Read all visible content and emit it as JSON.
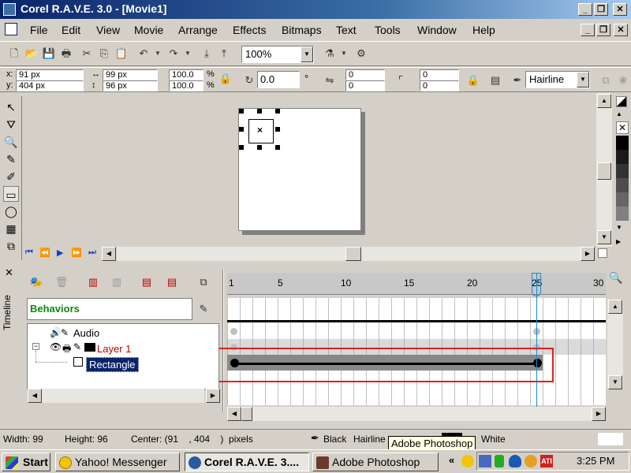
{
  "window": {
    "title": "Corel R.A.V.E. 3.0 - [Movie1]"
  },
  "menu": [
    "File",
    "Edit",
    "View",
    "Movie",
    "Arrange",
    "Effects",
    "Bitmaps",
    "Text",
    "Tools",
    "Window",
    "Help"
  ],
  "toolbar": {
    "zoom": "100%"
  },
  "propbar": {
    "x": "91 px",
    "y": "404 px",
    "w": "99 px",
    "h": "96 px",
    "scale_x": "100.0",
    "scale_y": "100.0",
    "pct": "%",
    "rotation": "0.0",
    "deg": "°",
    "pos1": "0",
    "pos2": "0",
    "pos3": "0",
    "pos4": "0",
    "outline": "Hairline"
  },
  "timeline": {
    "panel_label": "Timeline",
    "behaviors": "Behaviors",
    "frames": [
      "1",
      "5",
      "10",
      "15",
      "20",
      "25",
      "30"
    ],
    "layers": [
      {
        "name": "Audio"
      },
      {
        "name": "Layer 1"
      },
      {
        "name": "Rectangle"
      }
    ]
  },
  "statusbar": {
    "width": "Width: 99",
    "height": "Height: 96",
    "center": "Center: (91    , 404    )  pixels",
    "fill": "Black",
    "outline": "Hairline",
    "outline_color": "White",
    "tooltip": "Adobe Photoshop"
  },
  "taskbar": {
    "start": "Start",
    "tasks": [
      "Yahoo! Messenger",
      "Corel R.A.V.E. 3....",
      "Adobe Photoshop"
    ],
    "clock": "3:25 PM"
  },
  "colors": {
    "titlebar": "#0a246a",
    "selection": "#0a246a",
    "highlight_box": "#e02020",
    "layer_red": "#c00000"
  }
}
